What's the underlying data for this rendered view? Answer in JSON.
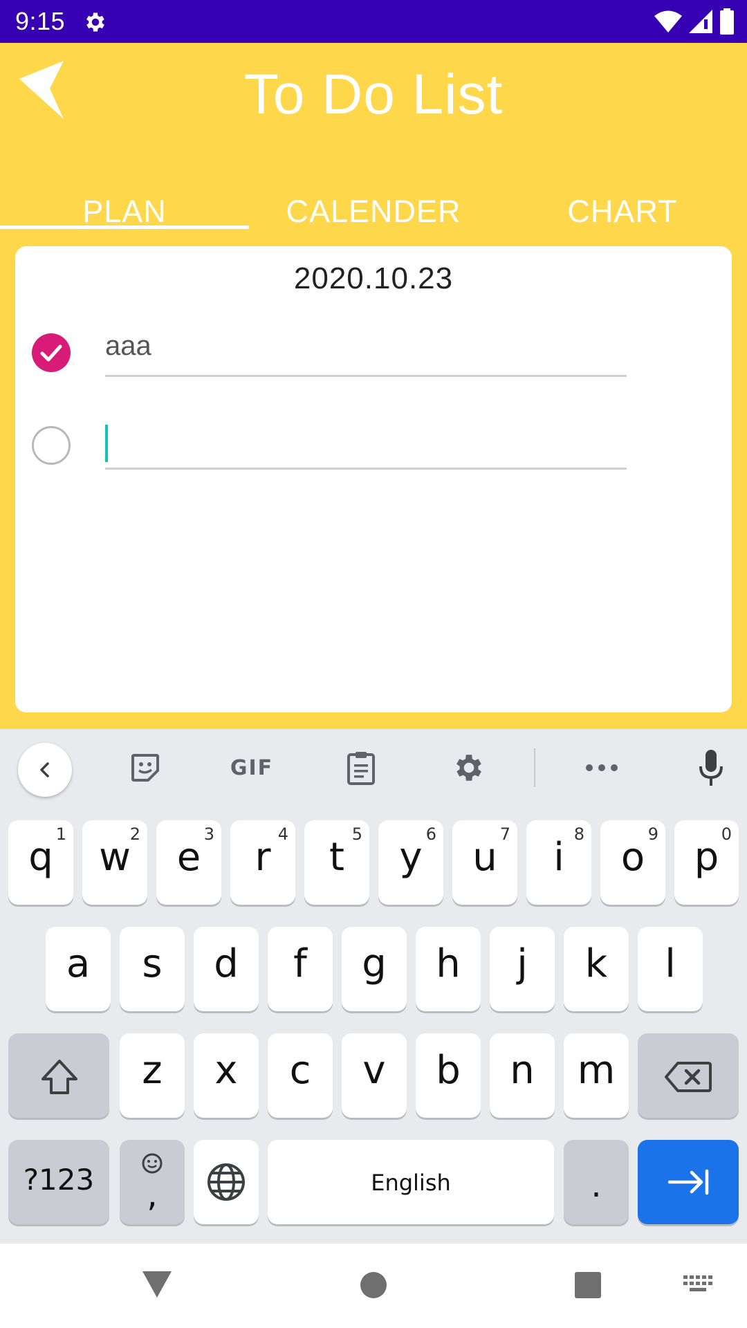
{
  "status_bar": {
    "time": "9:15",
    "icons": [
      "settings-icon",
      "wifi-icon",
      "signal-icon",
      "battery-icon"
    ]
  },
  "app_bar": {
    "title": "To Do List",
    "back_icon": "back-arrow-icon",
    "tabs": [
      {
        "label": "PLAN",
        "selected": true
      },
      {
        "label": "CALENDER",
        "selected": false
      },
      {
        "label": "CHART",
        "selected": false
      }
    ]
  },
  "card": {
    "date": "2020.10.23",
    "todos": [
      {
        "text": "aaa",
        "checked": true
      },
      {
        "text": "",
        "checked": false
      }
    ]
  },
  "keyboard": {
    "toolbar": [
      "collapse-icon",
      "sticker-icon",
      "GIF",
      "clipboard-icon",
      "settings-icon",
      "more-icon",
      "mic-icon"
    ],
    "gif_label": "GIF",
    "row1": [
      {
        "ch": "q",
        "hint": "1"
      },
      {
        "ch": "w",
        "hint": "2"
      },
      {
        "ch": "e",
        "hint": "3"
      },
      {
        "ch": "r",
        "hint": "4"
      },
      {
        "ch": "t",
        "hint": "5"
      },
      {
        "ch": "y",
        "hint": "6"
      },
      {
        "ch": "u",
        "hint": "7"
      },
      {
        "ch": "i",
        "hint": "8"
      },
      {
        "ch": "o",
        "hint": "9"
      },
      {
        "ch": "p",
        "hint": "0"
      }
    ],
    "row2": [
      "a",
      "s",
      "d",
      "f",
      "g",
      "h",
      "j",
      "k",
      "l"
    ],
    "row3": [
      "z",
      "x",
      "c",
      "v",
      "b",
      "n",
      "m"
    ],
    "sym_label": "?123",
    "comma_label": ",",
    "space_label": "English",
    "period_label": ".",
    "accent_color": "#1a73e8"
  },
  "colors": {
    "status_bar": "#3700b3",
    "app_background": "#fed74b",
    "check_done": "#d81b77",
    "cursor": "#13c4b4"
  }
}
